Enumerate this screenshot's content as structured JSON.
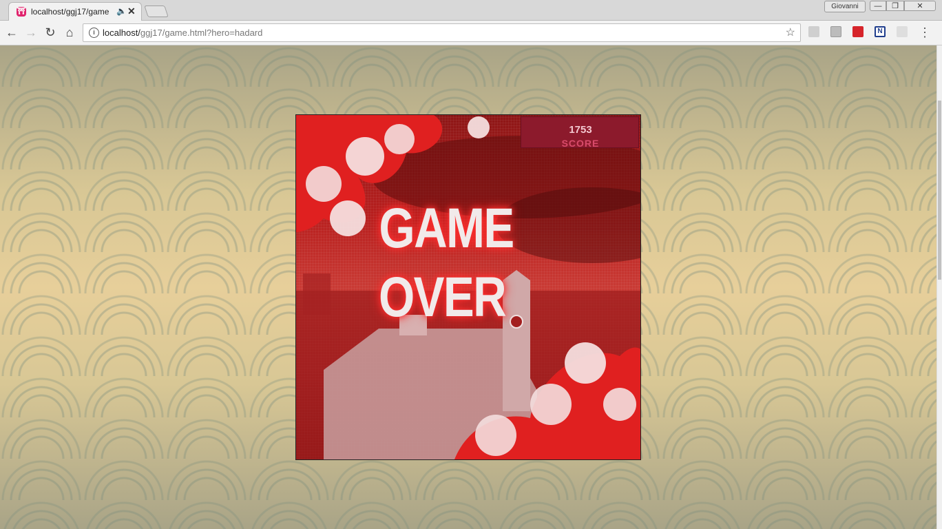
{
  "browser": {
    "tab": {
      "title": "localhost/ggj17/game",
      "favicon": "game-favicon-icon"
    },
    "profile_name": "Giovanni",
    "address": {
      "host": "localhost/",
      "path": "ggj17/game.html?hero=hadard"
    },
    "icons": {
      "back": "←",
      "forward": "→",
      "reload": "↻",
      "home": "⌂",
      "star": "☆",
      "menu": "⋮",
      "close": "✕",
      "audio": "🔈",
      "minimize": "—",
      "maximize": "❐",
      "win_close": "✕",
      "info": "i"
    },
    "extensions": [
      "cloud-extension-icon",
      "storage-extension-icon",
      "red-extension-icon",
      "n-extension-icon",
      "pdf-extension-icon"
    ]
  },
  "game": {
    "score_value": "1753",
    "score_label": "SCORE",
    "game_over": [
      "GAME",
      "OVER"
    ]
  },
  "colors": {
    "accent_red": "#d6242a",
    "game_bg": "#b8201f",
    "page_bg": "#e7cf9a"
  }
}
